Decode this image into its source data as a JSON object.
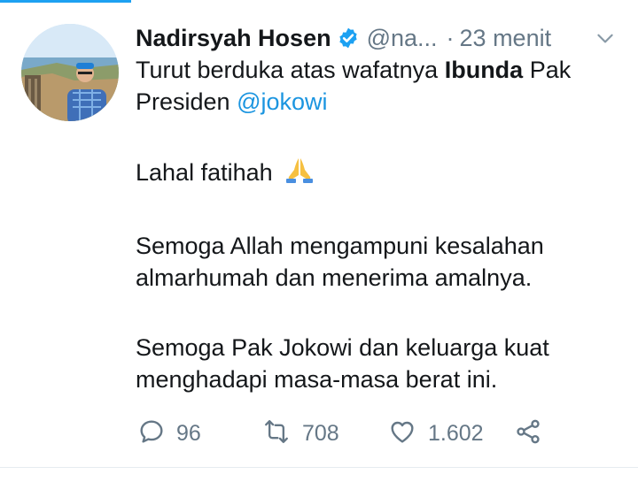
{
  "tweet": {
    "author_name": "Nadirsyah Hosen",
    "handle": "@na...",
    "separator": "·",
    "time": "23 menit",
    "icons": {
      "verified": "verified-badge-icon",
      "caret": "chevron-down-icon",
      "emoji": "folded-hands-emoji"
    },
    "text": {
      "line1_pre": "Turut berduka atas wafatnya ",
      "line1_bold": "Ibunda",
      "line1_post": " Pak",
      "line2_pre": "Presiden ",
      "mention": "@jokowi",
      "para2": "Lahal fatihah",
      "para3": "Semoga Allah mengampuni kesalahan almarhumah dan menerima amalnya.",
      "para4": "Semoga Pak Jokowi dan keluarga kuat menghadapi masa-masa berat ini."
    },
    "actions": {
      "reply_count": "96",
      "retweet_count": "708",
      "like_count": "1.602"
    },
    "colors": {
      "accent": "#1da1f2",
      "mention": "#1b95e0",
      "muted": "#657786",
      "text": "#14171a"
    }
  }
}
